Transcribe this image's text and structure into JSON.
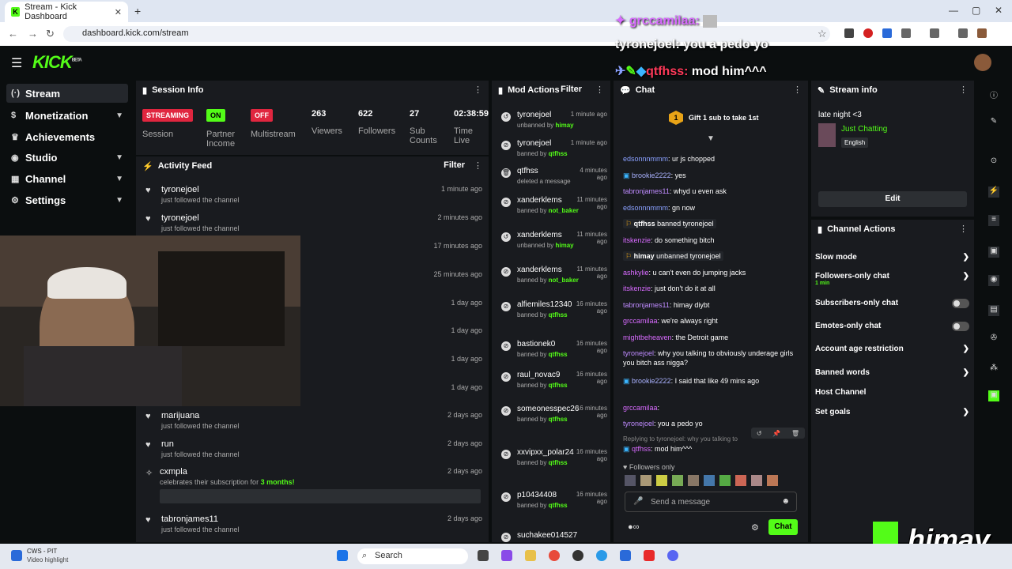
{
  "browser": {
    "tab_title": "Stream - Kick Dashboard",
    "url": "dashboard.kick.com/stream",
    "new_tab": "+"
  },
  "app": {
    "logo": "KICK",
    "logo_badge": "BETA"
  },
  "sidebar": {
    "items": [
      {
        "label": "Stream",
        "icon": "stream-icon",
        "active": true
      },
      {
        "label": "Monetization",
        "icon": "dollar-icon",
        "chevron": true
      },
      {
        "label": "Achievements",
        "icon": "trophy-icon"
      },
      {
        "label": "Studio",
        "icon": "studio-icon",
        "chevron": true
      },
      {
        "label": "Channel",
        "icon": "channel-icon",
        "chevron": true
      },
      {
        "label": "Settings",
        "icon": "gear-icon",
        "chevron": true
      }
    ]
  },
  "session": {
    "title": "Session Info",
    "streaming_badge": "STREAMING",
    "session_label": "Session",
    "on_badge": "ON",
    "partner_label": "Partner Income",
    "off_badge": "OFF",
    "multistream_label": "Multistream",
    "viewers": "263",
    "viewers_label": "Viewers",
    "followers": "622",
    "followers_label": "Followers",
    "subs": "27",
    "subs_label": "Sub Counts",
    "time": "02:38:59",
    "time_label": "Time Live"
  },
  "activity": {
    "title": "Activity Feed",
    "filter": "Filter",
    "rows": [
      {
        "name": "tyronejoel",
        "sub": "just followed the channel",
        "time": "1 minute ago"
      },
      {
        "name": "tyronejoel",
        "sub": "just followed the channel",
        "time": "2 minutes ago"
      },
      {
        "name": "",
        "sub": "",
        "time": "17 minutes ago"
      },
      {
        "name": "",
        "sub": "",
        "time": "25 minutes ago"
      },
      {
        "name": "",
        "sub": "",
        "time": "1 day ago"
      },
      {
        "name": "",
        "sub": "",
        "time": "1 day ago"
      },
      {
        "name": "",
        "sub": "",
        "time": "1 day ago"
      },
      {
        "name": "",
        "sub": "",
        "time": "1 day ago"
      },
      {
        "name": "marijuana",
        "sub": "just followed the channel",
        "time": "2 days ago"
      },
      {
        "name": "run",
        "sub": "just followed the channel",
        "time": "2 days ago"
      },
      {
        "name": "cxmpla",
        "sub": "celebrates their subscription for",
        "months": "3 months!",
        "time": "2 days ago"
      },
      {
        "name": "tabronjames11",
        "sub": "just followed the channel",
        "time": "2 days ago"
      }
    ]
  },
  "mod": {
    "title": "Mod Actions",
    "filter": "Filter",
    "rows": [
      {
        "name": "tyronejoel",
        "action": "unbanned by",
        "by": "himay",
        "time": "1 minute ago",
        "icon": "undo-icon"
      },
      {
        "name": "tyronejoel",
        "action": "banned by",
        "by": "qtfhss",
        "time": "1 minute ago",
        "icon": "ban-icon"
      },
      {
        "name": "qtfhss",
        "action": "deleted a message",
        "by": "",
        "time": "4 minutes ago",
        "icon": "trash-icon"
      },
      {
        "name": "xanderklems",
        "action": "banned by",
        "by": "not_baker",
        "time": "11 minutes ago",
        "icon": "ban-icon"
      },
      {
        "name": "xanderklems",
        "action": "unbanned by",
        "by": "himay",
        "time": "11 minutes ago",
        "icon": "undo-icon"
      },
      {
        "name": "xanderklems",
        "action": "banned by",
        "by": "not_baker",
        "time": "11 minutes ago",
        "icon": "ban-icon"
      },
      {
        "name": "alfiemiles12340",
        "action": "banned by",
        "by": "qtfhss",
        "time": "16 minutes ago",
        "icon": "ban-icon"
      },
      {
        "name": "bastionek0",
        "action": "banned by",
        "by": "qtfhss",
        "time": "16 minutes ago",
        "icon": "ban-icon"
      },
      {
        "name": "raul_novac9",
        "action": "banned by",
        "by": "qtfhss",
        "time": "16 minutes ago",
        "icon": "ban-icon"
      },
      {
        "name": "someonesspec26",
        "action": "banned by",
        "by": "qtfhss",
        "time": "16 minutes ago",
        "icon": "ban-icon"
      },
      {
        "name": "xxvipxx_polar24",
        "action": "banned by",
        "by": "qtfhss",
        "time": "16 minutes ago",
        "icon": "ban-icon"
      },
      {
        "name": "p10434408",
        "action": "banned by",
        "by": "qtfhss",
        "time": "16 minutes ago",
        "icon": "ban-icon"
      },
      {
        "name": "suchakee014527",
        "action": "",
        "by": "",
        "time": "",
        "icon": "ban-icon"
      }
    ]
  },
  "chat": {
    "title": "Chat",
    "gift": "Gift 1 sub to take 1st",
    "gift_count": "1",
    "lines": [
      {
        "user": "edsonnnmmm",
        "text": ": ur js chopped",
        "cls": "u1"
      },
      {
        "user": "brookie2222",
        "text": ": yes",
        "cls": "u3"
      },
      {
        "user": "tabronjames11",
        "text": ": whyd u even ask",
        "cls": "u4"
      },
      {
        "user": "edsonnnmmm",
        "text": ": gn now",
        "cls": "u1"
      },
      {
        "user": "qtfhss",
        "text": " banned tyronejoel",
        "cls": "sys"
      },
      {
        "user": "itskenzie",
        "text": ": do something bitch",
        "cls": "u2"
      },
      {
        "user": "himay",
        "text": " unbanned tyronejoel",
        "cls": "sys"
      },
      {
        "user": "ashkylie",
        "text": ": u can't even do jumping jacks",
        "cls": "u2"
      },
      {
        "user": "itskenzie",
        "text": ": just don't do it at all",
        "cls": "u2"
      },
      {
        "user": "tabronjames11",
        "text": ": himay diybt",
        "cls": "u4"
      },
      {
        "user": "grccamilaa",
        "text": ": we're always right",
        "cls": "u2"
      },
      {
        "user": "mightbeheaven",
        "text": ": the Detroit game",
        "cls": "u2"
      },
      {
        "user": "tyronejoel",
        "text": ": why you talking to obviously underage girls you bitch ass nigga?",
        "cls": "u4"
      },
      {
        "user": "brookie2222",
        "text": ": I said that like 49 mins ago",
        "cls": "u3"
      },
      {
        "user": "grccamilaa",
        "text": ":",
        "cls": "u2"
      },
      {
        "user": "tyronejoel",
        "text": ": you a pedo yo",
        "cls": "u4"
      },
      {
        "user": "qtfhss",
        "text": ": mod him^^^",
        "cls": "u2"
      }
    ],
    "reply_hint": "Replying to tyronejoel: why you talking to",
    "followers_only": "Followers only",
    "placeholder": "Send a message",
    "send": "Chat"
  },
  "stream_info": {
    "title": "Stream info",
    "stream_title": "late night <3",
    "category": "Just Chatting",
    "language": "English",
    "edit": "Edit"
  },
  "channel_actions": {
    "title": "Channel Actions",
    "rows": [
      {
        "label": "Slow mode",
        "type": "chevron"
      },
      {
        "label": "Followers-only chat",
        "sub": "1 min",
        "type": "chevron"
      },
      {
        "label": "Subscribers-only chat",
        "type": "toggle"
      },
      {
        "label": "Emotes-only chat",
        "type": "toggle"
      },
      {
        "label": "Account age restriction",
        "type": "chevron"
      },
      {
        "label": "Banned words",
        "type": "chevron"
      },
      {
        "label": "Host Channel",
        "type": "none"
      },
      {
        "label": "Set goals",
        "type": "chevron"
      }
    ]
  },
  "overlay": {
    "line1_user": "grccamilaa:",
    "line2": "tyronejoel: you a pedo yo",
    "line3_user": "qtfhss:",
    "line3_text": " mod him^^^",
    "brand": "himay"
  },
  "taskbar": {
    "app1": "CWS - PIT",
    "app1_sub": "Video highlight",
    "search": "Search"
  },
  "colors": {
    "kick_green": "#53fc18",
    "panel": "#191b1f",
    "streaming_red": "#e0263f"
  }
}
